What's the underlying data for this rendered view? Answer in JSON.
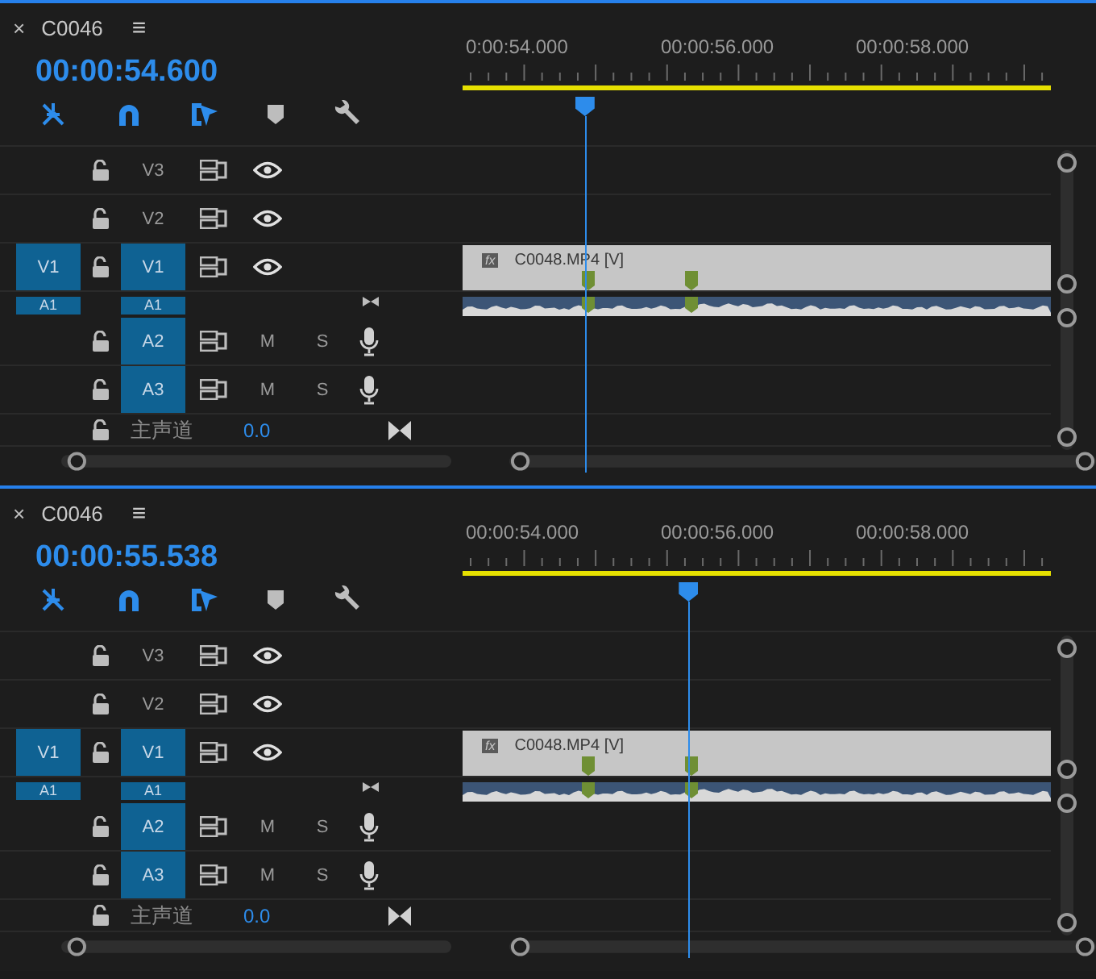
{
  "panels": [
    {
      "close": "×",
      "title": "C0046",
      "menu": "≡",
      "timecode": "00:00:54.600",
      "ruler": [
        "0:00:54.000",
        "00:00:56.000",
        "00:00:58.000"
      ],
      "playhead": {
        "level": 0.208
      },
      "tracks": [
        {
          "kind": "video",
          "label": "V3",
          "targeted": false
        },
        {
          "kind": "video",
          "label": "V2",
          "targeted": false
        },
        {
          "kind": "video",
          "label": "V1",
          "source": "V1",
          "targeted": true,
          "clip": "C0048.MP4 [V]",
          "fx": "fx"
        },
        {
          "kind": "audio-mini",
          "label": "A1",
          "source": "A1",
          "targeted": true
        },
        {
          "kind": "audio",
          "label": "A2",
          "targeted": true,
          "mute": "M",
          "solo": "S"
        },
        {
          "kind": "audio",
          "label": "A3",
          "targeted": true,
          "mute": "M",
          "solo": "S"
        },
        {
          "kind": "master",
          "label": "主声道",
          "value": "0.0"
        }
      ]
    },
    {
      "close": "×",
      "title": "C0046",
      "menu": "≡",
      "timecode": "00:00:55.538",
      "ruler": [
        "00:00:54.000",
        "00:00:56.000",
        "00:00:58.000"
      ],
      "playhead": {
        "level": 0.384
      },
      "tracks": [
        {
          "kind": "video",
          "label": "V3",
          "targeted": false
        },
        {
          "kind": "video",
          "label": "V2",
          "targeted": false
        },
        {
          "kind": "video",
          "label": "V1",
          "source": "V1",
          "targeted": true,
          "clip": "C0048.MP4 [V]",
          "fx": "fx"
        },
        {
          "kind": "audio-mini",
          "label": "A1",
          "source": "A1",
          "targeted": true
        },
        {
          "kind": "audio",
          "label": "A2",
          "targeted": true,
          "mute": "M",
          "solo": "S"
        },
        {
          "kind": "audio",
          "label": "A3",
          "targeted": true,
          "mute": "M",
          "solo": "S"
        },
        {
          "kind": "master",
          "label": "主声道",
          "value": "0.0"
        }
      ]
    }
  ]
}
